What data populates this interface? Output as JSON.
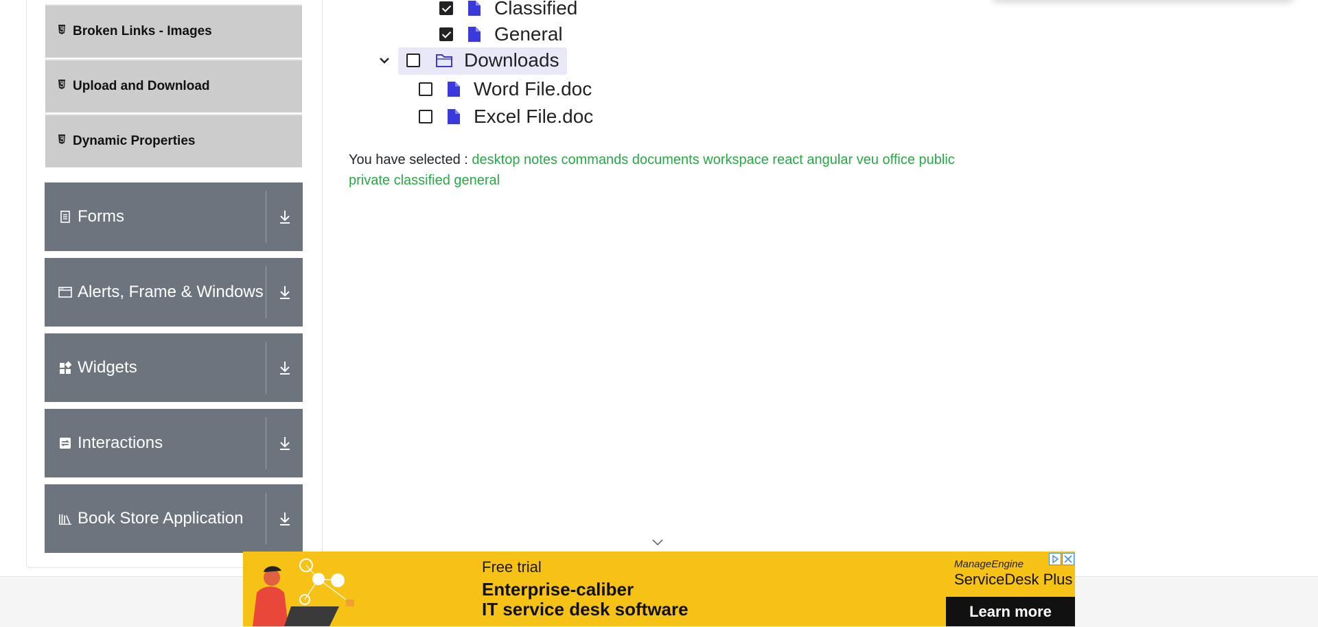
{
  "sidebar": {
    "sub_items": [
      {
        "label": "Broken Links - Images"
      },
      {
        "label": "Upload and Download"
      },
      {
        "label": "Dynamic Properties"
      }
    ],
    "groups": [
      {
        "label": "Forms",
        "icon": "form-icon"
      },
      {
        "label": "Alerts, Frame & Windows",
        "icon": "window-icon"
      },
      {
        "label": "Widgets",
        "icon": "widgets-icon"
      },
      {
        "label": "Interactions",
        "icon": "interactions-icon"
      },
      {
        "label": "Book Store Application",
        "icon": "books-icon"
      }
    ]
  },
  "tree": {
    "nodes": [
      {
        "label": "Classified",
        "checked": true
      },
      {
        "label": "General",
        "checked": true
      },
      {
        "label": "Downloads",
        "checked": false,
        "expanded": true
      },
      {
        "label": "Word File.doc",
        "checked": false
      },
      {
        "label": "Excel File.doc",
        "checked": false
      }
    ]
  },
  "result": {
    "prefix": "You have selected :",
    "items_line1": "desktop notes commands documents workspace react angular veu office public",
    "items_line2": "private classified general"
  },
  "ad": {
    "free_trial": "Free trial",
    "headline_1": "Enterprise-caliber",
    "headline_2": "IT service desk software",
    "brand_small": "ManageEngine",
    "brand_big": "ServiceDesk Plus",
    "cta": "Learn more"
  },
  "colors": {
    "sidebar_group_bg": "#6c757d",
    "sidebar_sub_bg": "#cccccc",
    "selected_items": "#28a745",
    "file_icon": "#3a3adb",
    "ad_bg": "#f6c215"
  }
}
